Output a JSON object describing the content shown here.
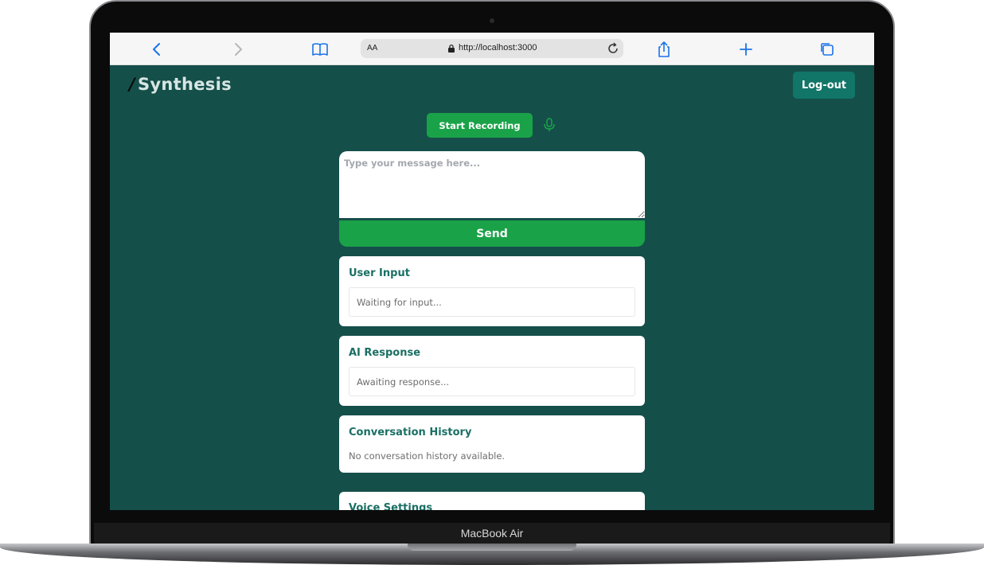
{
  "device": {
    "label": "MacBook Air"
  },
  "browser": {
    "text_size_label": "AA",
    "url": "http://localhost:3000"
  },
  "app": {
    "brand_slash": "/",
    "brand_name": "Synthesis",
    "logout_label": "Log-out",
    "record_label": "Start Recording",
    "message_placeholder": "Type your message here...",
    "send_label": "Send",
    "user_input": {
      "title": "User Input",
      "value": "Waiting for input..."
    },
    "ai_response": {
      "title": "AI Response",
      "value": "Awaiting response..."
    },
    "history": {
      "title": "Conversation History",
      "empty_text": "No conversation history available."
    },
    "voice_settings": {
      "title": "Voice Settings"
    }
  },
  "colors": {
    "background": "#154f4a",
    "accent_green": "#1aa248",
    "logout_teal": "#117567",
    "title_teal": "#1a6f64"
  }
}
